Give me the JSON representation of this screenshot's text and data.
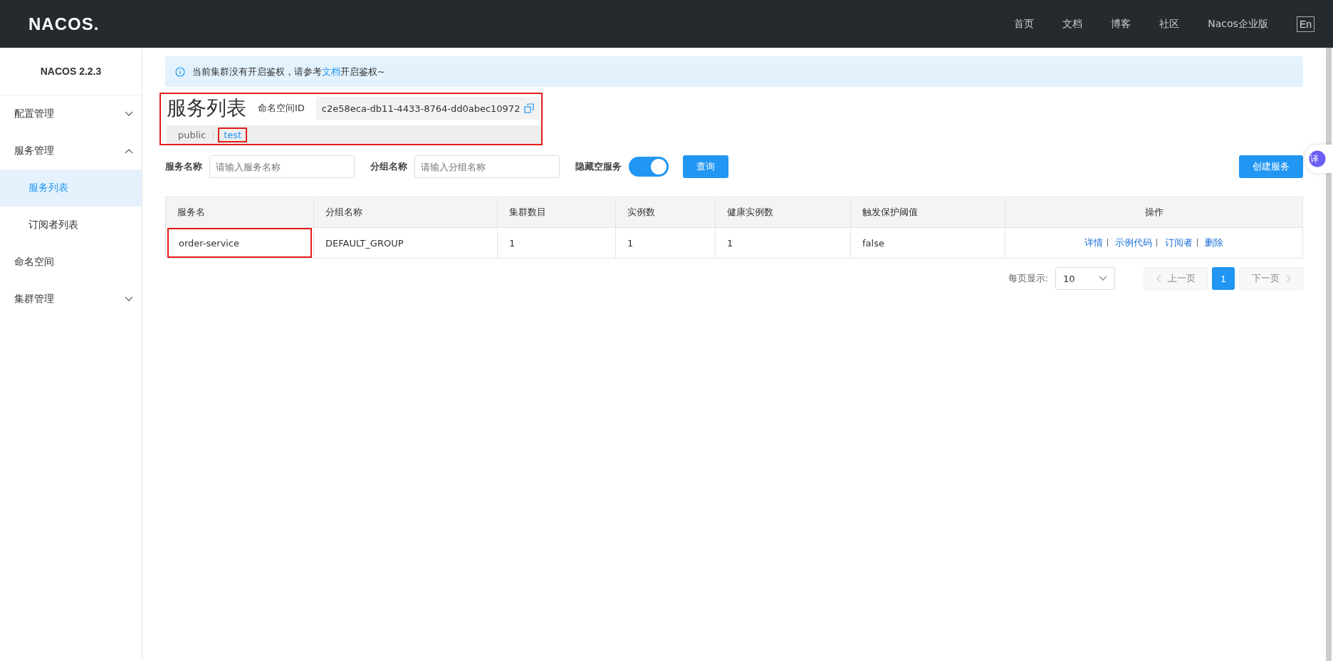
{
  "header": {
    "logo": "NACOS.",
    "nav": [
      "首页",
      "文档",
      "博客",
      "社区",
      "Nacos企业版"
    ],
    "lang_button": "En"
  },
  "sidebar": {
    "version": "NACOS 2.2.3",
    "items": [
      {
        "label": "配置管理",
        "expanded": false,
        "selected": false
      },
      {
        "label": "服务管理",
        "expanded": true,
        "selected": false,
        "children": [
          {
            "label": "服务列表",
            "selected": true
          },
          {
            "label": "订阅者列表",
            "selected": false
          }
        ]
      },
      {
        "label": "命名空间",
        "selected": false
      },
      {
        "label": "集群管理",
        "expanded": false,
        "selected": false
      }
    ]
  },
  "alert": {
    "text_before": "当前集群没有开启鉴权，请参考",
    "link": "文档",
    "text_after": "开启鉴权~"
  },
  "page": {
    "title": "服务列表",
    "namespace_label": "命名空间ID",
    "namespace_id": "c2e58eca-db11-4433-8764-dd0abec10972",
    "highlighted": true,
    "namespaces": [
      {
        "label": "public",
        "selected": false,
        "highlighted": false
      },
      {
        "label": "test",
        "selected": true,
        "highlighted": true
      }
    ]
  },
  "filters": {
    "service_label": "服务名称",
    "service_placeholder": "请输入服务名称",
    "group_label": "分组名称",
    "group_placeholder": "请输入分组名称",
    "hide_empty_label": "隐藏空服务",
    "hide_empty_on": true,
    "query_button": "查询",
    "create_button": "创建服务"
  },
  "table": {
    "columns": [
      "服务名",
      "分组名称",
      "集群数目",
      "实例数",
      "健康实例数",
      "触发保护阈值",
      "操作"
    ],
    "rows": [
      {
        "cells": [
          "order-service",
          "DEFAULT_GROUP",
          "1",
          "1",
          "1",
          "false"
        ],
        "highlighted": true,
        "actions": [
          "详情",
          "示例代码",
          "订阅者",
          "删除"
        ]
      }
    ]
  },
  "pagination": {
    "page_size_label": "每页显示:",
    "page_size": "10",
    "prev": "上一页",
    "next": "下一页",
    "pages": [
      {
        "label": "1",
        "selected": true
      }
    ]
  },
  "floating_button": "译"
}
